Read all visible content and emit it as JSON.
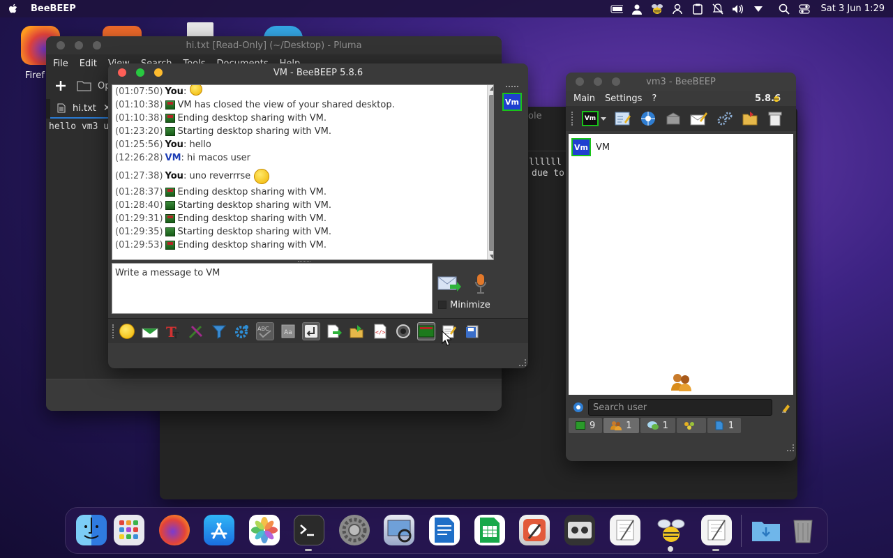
{
  "menubar": {
    "app_name": "BeeBEEP",
    "clock": "Sat 3 Jun 1:29"
  },
  "desktop": {
    "firefox_label": "Firef"
  },
  "pluma": {
    "title": "hi.txt [Read-Only] (~/Desktop) - Pluma",
    "menu": [
      "File",
      "Edit",
      "View",
      "Search",
      "Tools",
      "Documents",
      "Help"
    ],
    "open_label": "Op",
    "tab_label": "hi.txt",
    "content": "hello vm3 u"
  },
  "background_window": {
    "title_fragment": "ole",
    "line1": "llllll",
    "line2": "due to"
  },
  "chat": {
    "title": "VM - BeeBEEP 5.8.6",
    "messages": [
      {
        "time": "(01:07:50)",
        "who": "You",
        "text": ":",
        "kind": "you",
        "icon": "smiley"
      },
      {
        "time": "(01:10:38)",
        "text": "VM has closed the view of your shared desktop.",
        "kind": "sys",
        "icon": "red"
      },
      {
        "time": "(01:10:38)",
        "text": "Ending desktop sharing with VM.",
        "kind": "sys",
        "icon": "red"
      },
      {
        "time": "(01:23:20)",
        "text": "Starting desktop sharing with VM.",
        "kind": "sys",
        "icon": "green"
      },
      {
        "time": "(01:25:56)",
        "who": "You",
        "text": ": hello",
        "kind": "you"
      },
      {
        "time": "(12:26:28)",
        "who": "VM",
        "text": ": hi macos user",
        "kind": "vm"
      },
      {
        "time": "(01:27:38)",
        "who": "You",
        "text": ": uno reverrrse",
        "kind": "you",
        "icon": "smiley"
      },
      {
        "time": "(01:28:37)",
        "text": "Ending desktop sharing with VM.",
        "kind": "sys",
        "icon": "red"
      },
      {
        "time": "(01:28:40)",
        "text": "Starting desktop sharing with VM.",
        "kind": "sys",
        "icon": "green"
      },
      {
        "time": "(01:29:31)",
        "text": "Ending desktop sharing with VM.",
        "kind": "sys",
        "icon": "red"
      },
      {
        "time": "(01:29:35)",
        "text": "Starting desktop sharing with VM.",
        "kind": "sys",
        "icon": "green"
      },
      {
        "time": "(01:29:53)",
        "text": "Ending desktop sharing with VM.",
        "kind": "sys",
        "icon": "red"
      }
    ],
    "input_placeholder": "Write a message to VM",
    "minimize_label": "Minimize",
    "avatar_label": "Vm"
  },
  "vm3": {
    "title": "vm3 - BeeBEEP",
    "menu": [
      "Main",
      "Settings",
      "?"
    ],
    "version": "5.8.6",
    "user": {
      "avatar": "Vm",
      "name": "VM"
    },
    "search_placeholder": "Search user",
    "tabs": [
      {
        "icon": "chat-icon",
        "count": "9"
      },
      {
        "icon": "users-icon",
        "count": "1"
      },
      {
        "icon": "bubble-icon",
        "count": "1"
      },
      {
        "icon": "group-icon",
        "count": ""
      },
      {
        "icon": "file-icon",
        "count": "1"
      }
    ]
  },
  "colors": {
    "accent_blue": "#1f3fd0",
    "status_green": "#19c419"
  }
}
